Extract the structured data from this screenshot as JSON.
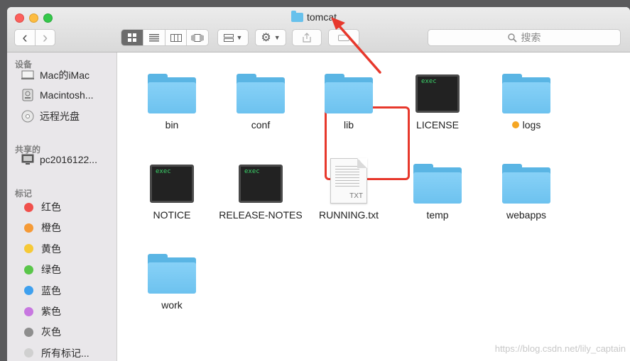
{
  "window": {
    "title": "tomcat"
  },
  "toolbar": {
    "back_glyph": "‹",
    "forward_glyph": "›",
    "search_placeholder": "搜索",
    "view_modes": [
      "icon",
      "list",
      "column",
      "cover-flow"
    ],
    "active_view": "icon"
  },
  "sidebar": {
    "sections": [
      {
        "title": "设备",
        "items": [
          {
            "label": "Mac的iMac",
            "icon": "computer-icon"
          },
          {
            "label": "Macintosh...",
            "icon": "disk-icon"
          },
          {
            "label": "远程光盘",
            "icon": "optical-disc-icon"
          }
        ]
      },
      {
        "title": "共享的",
        "items": [
          {
            "label": "pc2016122...",
            "icon": "network-pc-icon"
          }
        ]
      },
      {
        "title": "标记",
        "items": [
          {
            "label": "红色",
            "color": "#f0504c"
          },
          {
            "label": "橙色",
            "color": "#f59a36"
          },
          {
            "label": "黄色",
            "color": "#f6c937"
          },
          {
            "label": "绿色",
            "color": "#5ac64a"
          },
          {
            "label": "蓝色",
            "color": "#3fa0ee"
          },
          {
            "label": "紫色",
            "color": "#c777e0"
          },
          {
            "label": "灰色",
            "color": "#8e8e8e"
          },
          {
            "label": "所有标记...",
            "color": "#d0d0d0"
          }
        ]
      }
    ]
  },
  "files": [
    {
      "name": "bin",
      "kind": "folder"
    },
    {
      "name": "conf",
      "kind": "folder",
      "highlighted": true
    },
    {
      "name": "lib",
      "kind": "folder"
    },
    {
      "name": "LICENSE",
      "kind": "exec",
      "icon_text": "exec"
    },
    {
      "name": "logs",
      "kind": "folder",
      "tag_color": "#f5a623"
    },
    {
      "name": "NOTICE",
      "kind": "exec",
      "icon_text": "exec"
    },
    {
      "name": "RELEASE-NOTES",
      "kind": "exec",
      "icon_text": "exec"
    },
    {
      "name": "RUNNING.txt",
      "kind": "text",
      "icon_text": "TXT"
    },
    {
      "name": "temp",
      "kind": "folder"
    },
    {
      "name": "webapps",
      "kind": "folder"
    },
    {
      "name": "work",
      "kind": "folder"
    }
  ],
  "watermark": "https://blog.csdn.net/lily_captain",
  "colors": {
    "annotation": "#e7382c",
    "folder": "#6dc2ef"
  }
}
